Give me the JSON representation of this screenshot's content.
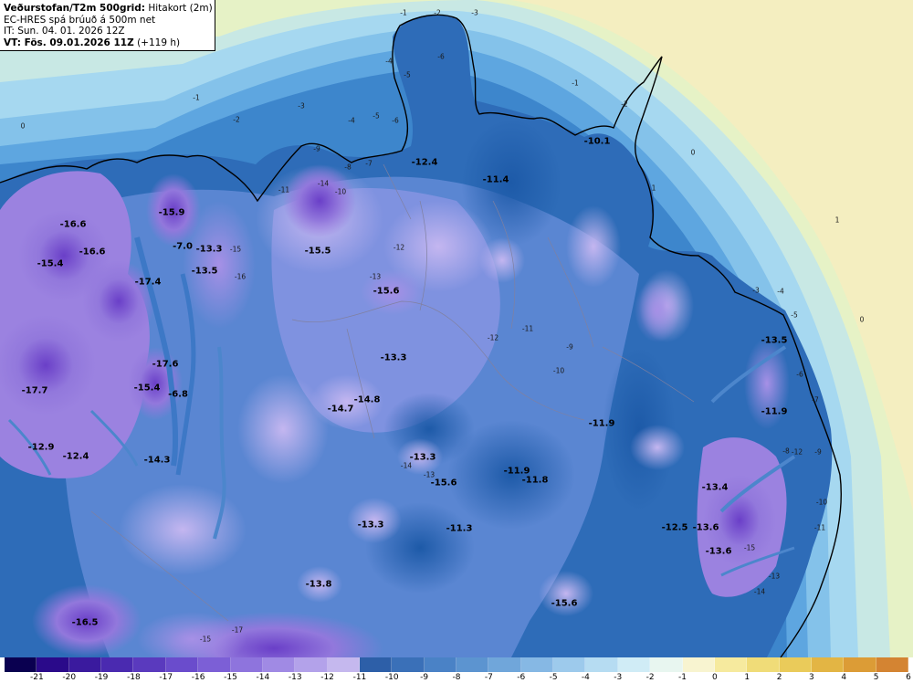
{
  "header": {
    "title_bold": "Veðurstofan/T2m 500grid:",
    "title_rest": "Hitakort (2m)",
    "model_line": "EC-HRES spá brúuð á 500m net",
    "it_line": "IT: Sun. 04. 01. 2026 12Z",
    "vt_bold": "VT: Fös. 09.01.2026 11Z",
    "vt_rest": "(+119 h)"
  },
  "colors": {
    "sea_pos": "#eef6c8",
    "sea_zero": "#d8eebe",
    "sea_neg1": "#a8dcf2",
    "sea_neg2": "#7cc4ec",
    "deep_blue": "#1f5fae",
    "mid_blue": "#3c7fc6",
    "light_blue": "#6a98d6",
    "purple_light": "#a89ae8",
    "purple_mid": "#8a6fd8",
    "purple_dark": "#5e3ab8",
    "yellow": "#f6e8a0",
    "coast": "#000000"
  },
  "legend": {
    "colors": [
      "#0a0050",
      "#2a0a8a",
      "#3a1a9e",
      "#4a2ab0",
      "#5a3abe",
      "#6a4ccc",
      "#7c5fd6",
      "#8e74dd",
      "#a08ae4",
      "#b3a2ea",
      "#c5b8ee",
      "#2d5fa8",
      "#3a70b8",
      "#4a82c6",
      "#5c94d0",
      "#70a6da",
      "#86b8e4",
      "#9dcaec",
      "#b6dcf2",
      "#d0ecf6",
      "#e8f6f0",
      "#f8f4d0",
      "#f6ea9e",
      "#f0dc78",
      "#eacb5a",
      "#e3b544",
      "#dc9c36",
      "#d48432"
    ],
    "ticks": [
      "-21",
      "-20",
      "-19",
      "-18",
      "-17",
      "-16",
      "-15",
      "-14",
      "-13",
      "-12",
      "-11",
      "-10",
      "-9",
      "-8",
      "-7",
      "-6",
      "-5",
      "-4",
      "-3",
      "-2",
      "-1",
      "0",
      "1",
      "2",
      "3",
      "4",
      "5",
      "6"
    ]
  },
  "map": {
    "value_labels": [
      "-16.6",
      "-15.9",
      "-13.3",
      "-16.6",
      "-15.4",
      "-17.4",
      "-13.5",
      "-7.0",
      "-15.5",
      "-15.6",
      "-12.4",
      "-11.4",
      "-10.1",
      "-17.6",
      "-15.4",
      "-6.8",
      "-17.7",
      "-13.3",
      "-14.7",
      "-14.8",
      "-12.9",
      "-12.4",
      "-14.3",
      "-13.3",
      "-15.6",
      "-11.9",
      "-11.8",
      "-11.9",
      "-13.3",
      "-11.3",
      "-13.8",
      "-16.5",
      "-15.6",
      "-13.5",
      "-11.9",
      "-13.4",
      "-12.5",
      "-13.6",
      "-13.6"
    ],
    "contour_labels": [
      "-1",
      "-2",
      "-3",
      "-4",
      "-5",
      "-6",
      "0",
      "1",
      "0",
      "-1",
      "-2",
      "-3",
      "-4",
      "-5",
      "-6",
      "-7",
      "-8",
      "-9",
      "-10",
      "-11",
      "-12",
      "-13",
      "-14",
      "-15",
      "-16",
      "-1",
      "-2",
      "0",
      "1",
      "-3",
      "-4",
      "-5",
      "-6",
      "-7",
      "-8",
      "-9",
      "-10",
      "-11",
      "-12",
      "-13",
      "-14",
      "-15",
      "-9",
      "-10",
      "-11",
      "-12",
      "-13",
      "-14",
      "-15",
      "-16",
      "-17"
    ]
  }
}
